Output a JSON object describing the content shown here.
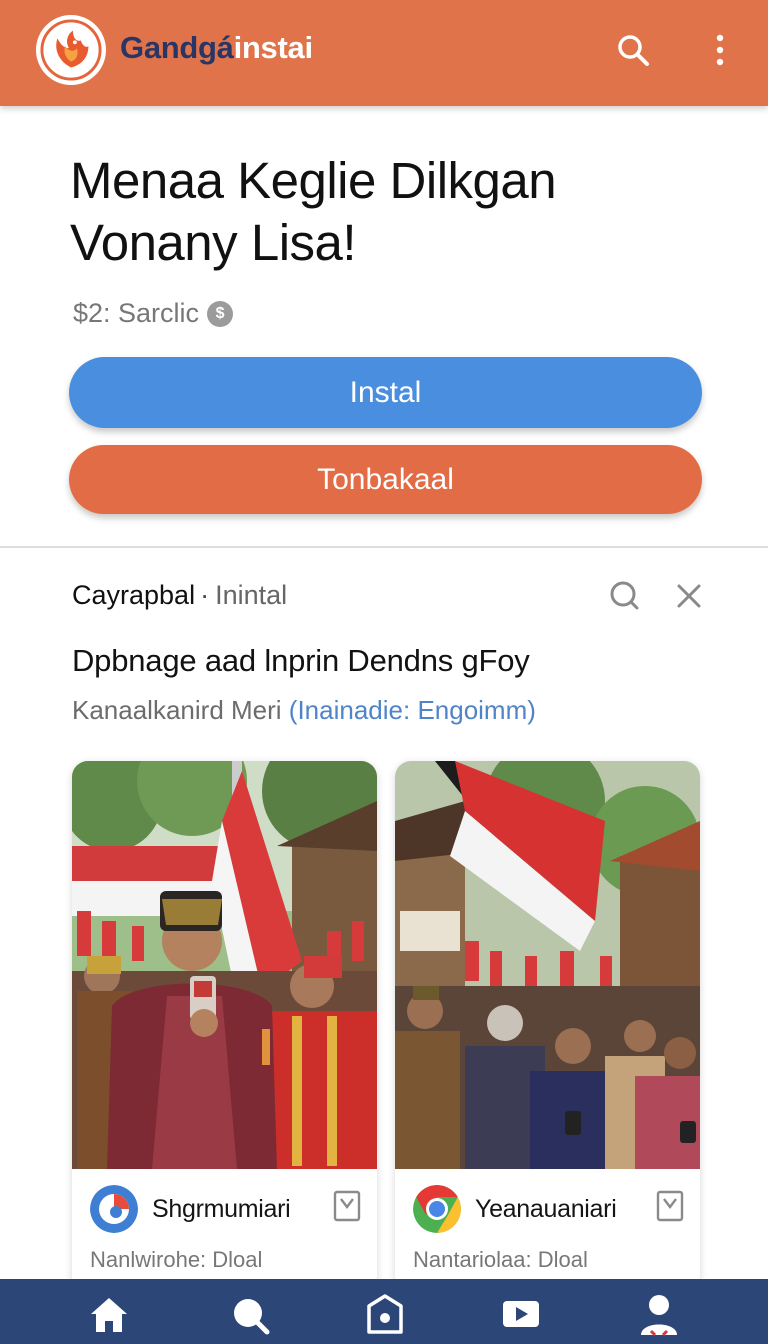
{
  "app": {
    "title_dark": "Gandgá",
    "title_light": "instai",
    "colors": {
      "appbar": "#e0734a",
      "install": "#4a8fdf",
      "download": "#e26c46",
      "bottomnav": "#2c4678",
      "link": "#4f84c9"
    }
  },
  "hero": {
    "title": "Menaa Keglie Dilkgan Vonany Lisa!",
    "price": "$2: Sarclic",
    "price_icon": "$",
    "install_label": "Instal",
    "download_label": "Tonbakaal"
  },
  "article": {
    "source": "Cayrapbal",
    "separator": "·",
    "source_sub": "Inintal",
    "headline": "Dpbnage aad lnprin Dendns gFoy",
    "byline": "Kanaalkanird Meri",
    "byline_link": "(Inainadie: Engoimm)"
  },
  "cards": [
    {
      "name": "Shgrmumiari",
      "sub": "Nanlwirohe: Dloal",
      "icon": "blue-circle-app-icon"
    },
    {
      "name": "Yeanauaniari",
      "sub": "Nantariolaa: Dloal",
      "icon": "chrome-like-icon"
    }
  ],
  "nav": {
    "items": [
      "home-icon",
      "search-icon",
      "store-icon",
      "video-icon",
      "profile-icon"
    ]
  }
}
